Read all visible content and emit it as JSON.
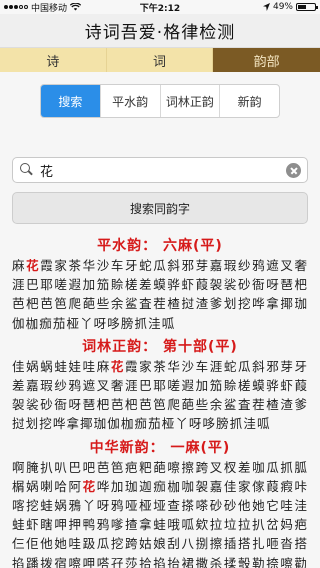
{
  "status": {
    "carrier": "中国移动",
    "wifi_icon": "wifi-icon",
    "time": "下午2:12",
    "location_icon": "location-arrow-icon",
    "battery": "49%",
    "battery_level": 0.49
  },
  "header": {
    "title": "诗词吾爱·格律检测"
  },
  "tabs": [
    {
      "label": "诗",
      "active": false
    },
    {
      "label": "词",
      "active": false
    },
    {
      "label": "韵部",
      "active": true
    }
  ],
  "segments": [
    {
      "label": "搜索",
      "active": true
    },
    {
      "label": "平水韵",
      "active": false
    },
    {
      "label": "词林正韵",
      "active": false
    },
    {
      "label": "新韵",
      "active": false
    }
  ],
  "search": {
    "value": "花",
    "button_label": "搜索同韵字"
  },
  "highlight_char": "花",
  "groups": [
    {
      "title": "平水韵： 六麻(平)",
      "chars": "麻花霞家茶华沙车牙蛇瓜斜邪芽嘉瑕纱鸦遮叉奢涯巴耶嗟遐加笳賒槎差蟆骅虾葭袈裟砂衙呀琶杷芭杷芭笆爬葩些余鲨査茬楂挝渣爹划挖哗拿揶珈伽枷痂茄桠丫呀哆膀抓洼呱"
    },
    {
      "title": "词林正韵： 第十部(平)",
      "chars": "佳娲蜗蛙娃哇麻花霞家茶华沙车涯蛇瓜斜邪芽牙差嘉瑕纱鸦遮叉奢涯巴耶嗟遐加笳賒槎蟆骅虾葭袈裟砂衙呀琶杷芭杷芭笆爬葩些余鲨査茬楂渣爹挝划挖哗拿揶珈伽枷痂茄桠丫呀哆膀抓洼呱"
    },
    {
      "title": "中华新韵： 一麻(平)",
      "chars": "啊腌扒叭巴吧芭笆疤粑葩嚓擦跨叉杈差咖瓜抓胍榍娲喇哈阿花哗加珈迦痂枷咖袈嘉佳家傢葭瘕咔喀挖蛙娲鴉丫呀鸦哑桠垭查搽嗏砂砂他她它哇洼蛙虾瞎呷押鸭鸦嗲揸拿蛙哦呱欸拉垃拉扒岔妈疤仨佢他她哇趿瓜挖跨姑娘刮八捌擦插搭扎咂沓搭掐蹯拨宿嚓呷嗒孖莎拾掐抬裙撒杀揉彀勒捺嚓勸桃摘挖押嗏嘁嘎压抻扎"
    }
  ]
}
